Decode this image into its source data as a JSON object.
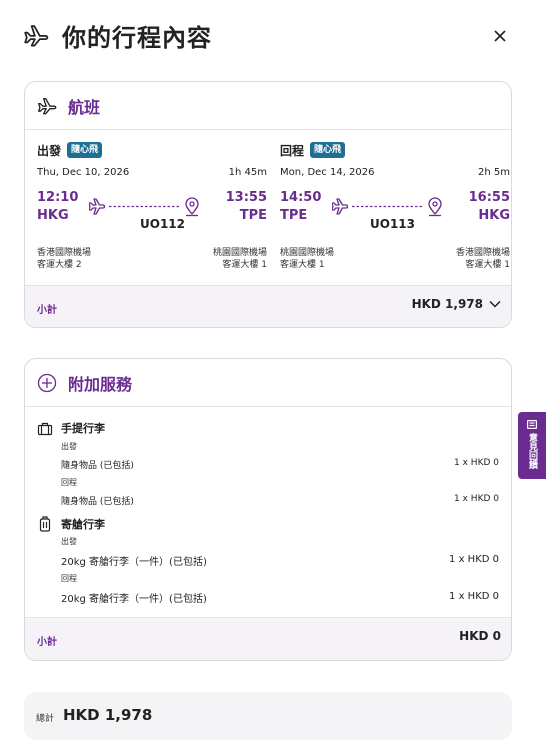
{
  "header": {
    "title": "你的行程內容"
  },
  "flight_card": {
    "title": "航班",
    "legs": [
      {
        "direction": "出發",
        "badge": "隨心飛",
        "date": "Thu, Dec 10, 2026",
        "duration": "1h 45m",
        "dep_time": "12:10",
        "arr_time": "13:55",
        "dep_code": "HKG",
        "arr_code": "TPE",
        "flight_no": "UO112",
        "dep_airport": "香港國際機場",
        "dep_terminal": "客運大樓 2",
        "arr_airport": "桃園國際機場",
        "arr_terminal": "客運大樓 1"
      },
      {
        "direction": "回程",
        "badge": "隨心飛",
        "date": "Mon, Dec 14, 2026",
        "duration": "2h 5m",
        "dep_time": "14:50",
        "arr_time": "16:55",
        "dep_code": "TPE",
        "arr_code": "HKG",
        "flight_no": "UO113",
        "dep_airport": "桃園國際機場",
        "dep_terminal": "客運大樓 1",
        "arr_airport": "香港國際機場",
        "arr_terminal": "客運大樓 1"
      }
    ],
    "subtotal_label": "小計",
    "subtotal_value": "HKD 1,978"
  },
  "extras_card": {
    "title": "附加服務",
    "cabin": {
      "title": "手提行李",
      "segments": [
        {
          "label": "出發",
          "item": "隨身物品 (已包括)",
          "qty": "1 x HKD 0"
        },
        {
          "label": "回程",
          "item": "隨身物品 (已包括)",
          "qty": "1 x HKD 0"
        }
      ]
    },
    "checked": {
      "title": "寄艙行李",
      "segments": [
        {
          "label": "出發",
          "item": "20kg 寄艙行李（一件）(已包括)",
          "qty": "1 x HKD 0"
        },
        {
          "label": "回程",
          "item": "20kg 寄艙行李（一件）(已包括)",
          "qty": "1 x HKD 0"
        }
      ]
    },
    "subtotal_label": "小計",
    "subtotal_value": "HKD 0"
  },
  "total": {
    "label": "總計",
    "value": "HKD 1,978"
  },
  "feedback": {
    "label": "意見回饋"
  },
  "colors": {
    "brand": "#6b2c91",
    "badge": "#1e6e95"
  }
}
